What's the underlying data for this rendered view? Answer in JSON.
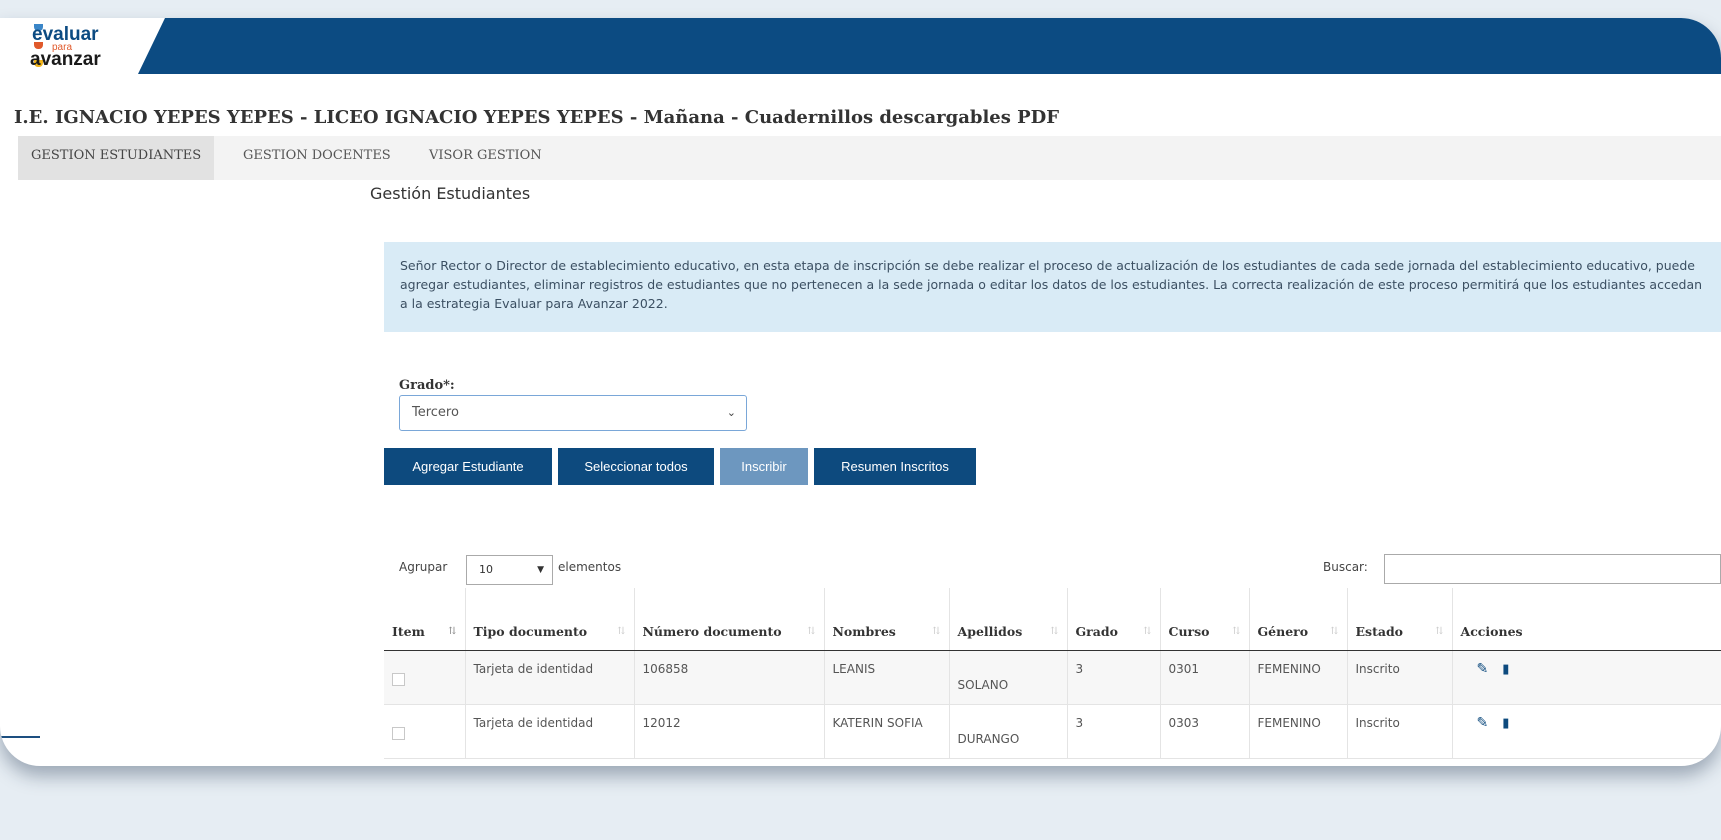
{
  "brand": {
    "logo_line1": "evaluar",
    "logo_line2": "para",
    "logo_line3": "avanzar",
    "colors": {
      "header": "#0c4b82",
      "button": "#0d4a7e",
      "info_bg": "#d9ebf6"
    }
  },
  "school_title": "I.E. IGNACIO YEPES YEPES - LICEO IGNACIO YEPES YEPES - Mañana - Cuadernillos descargables PDF",
  "nav": {
    "items": [
      {
        "label": "GESTION ESTUDIANTES",
        "active": true
      },
      {
        "label": "GESTION DOCENTES",
        "active": false
      },
      {
        "label": "VISOR GESTION",
        "active": false
      }
    ]
  },
  "page_heading": "Gestión Estudiantes",
  "info_text": "Señor Rector o Director de establecimiento educativo, en esta etapa de inscripción se debe realizar el proceso de actualización de los estudiantes de cada sede jornada del establecimiento educativo, puede agregar estudiantes, eliminar registros de estudiantes que no pertenecen a la sede jornada o editar los datos de los estudiantes. La correcta realización de este proceso permitirá que los estudiantes accedan a la estrategia Evaluar para Avanzar 2022.",
  "grado": {
    "label": "Grado*:",
    "value": "Tercero"
  },
  "buttons": {
    "agregar": "Agregar Estudiante",
    "seleccionar": "Seleccionar todos",
    "inscribir": "Inscribir",
    "resumen": "Resumen Inscritos"
  },
  "table_controls": {
    "length_label": "Agrupar",
    "length_value": "10",
    "length_suffix": "elementos",
    "search_label": "Buscar:"
  },
  "table": {
    "headers": {
      "item": "Item",
      "tipo": "Tipo documento",
      "numero": "Número documento",
      "nombres": "Nombres",
      "apellidos": "Apellidos",
      "grado": "Grado",
      "curso": "Curso",
      "genero": "Género",
      "estado": "Estado",
      "acciones": "Acciones"
    },
    "rows": [
      {
        "tipo": "Tarjeta de identidad",
        "numero": "106858",
        "nombres": "LEANIS",
        "apellidos": "SOLANO",
        "grado": "3",
        "curso": "0301",
        "genero": "FEMENINO",
        "estado": "Inscrito"
      },
      {
        "tipo": "Tarjeta de identidad",
        "numero": "12012",
        "nombres": "KATERIN SOFIA",
        "apellidos": "DURANGO",
        "grado": "3",
        "curso": "0303",
        "genero": "FEMENINO",
        "estado": "Inscrito"
      }
    ]
  }
}
